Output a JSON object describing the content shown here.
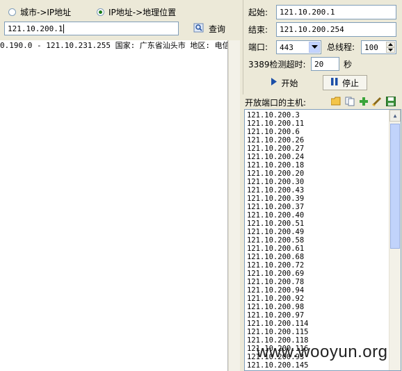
{
  "left": {
    "radio_city_to_ip": "城市->IP地址",
    "radio_ip_to_geo": "IP地址->地理位置",
    "selected_mode": "ip_to_geo",
    "query_input_value": "121.10.200.1",
    "query_button": "查询",
    "result_line": "0.190.0 - 121.10.231.255 国家: 广东省汕头市 地区: 电信"
  },
  "right": {
    "start_label": "起始:",
    "start_value": "121.10.200.1",
    "end_label": "结束:",
    "end_value": "121.10.200.254",
    "port_label": "端口:",
    "port_value": "443",
    "threads_label": "总线程:",
    "threads_value": "100",
    "timeout_label": "3389检测超时:",
    "timeout_value": "20",
    "timeout_unit": "秒",
    "start_button": "开始",
    "stop_button": "停止",
    "open_hosts_label": "开放端口的主机:",
    "toolbar_icons": [
      "folder-icon",
      "copy-icon",
      "add-icon",
      "clean-icon",
      "save-icon"
    ],
    "hosts": [
      "121.10.200.3",
      "121.10.200.11",
      "121.10.200.6",
      "121.10.200.26",
      "121.10.200.27",
      "121.10.200.24",
      "121.10.200.18",
      "121.10.200.20",
      "121.10.200.30",
      "121.10.200.43",
      "121.10.200.39",
      "121.10.200.37",
      "121.10.200.40",
      "121.10.200.51",
      "121.10.200.49",
      "121.10.200.58",
      "121.10.200.61",
      "121.10.200.68",
      "121.10.200.72",
      "121.10.200.69",
      "121.10.200.78",
      "121.10.200.94",
      "121.10.200.92",
      "121.10.200.98",
      "121.10.200.97",
      "121.10.200.114",
      "121.10.200.115",
      "121.10.200.118",
      "121.10.200.116",
      "121.10.200.93",
      "121.10.200.145"
    ]
  },
  "watermark": "www.wooyun.org",
  "colors": {
    "window_bg": "#ece9d8",
    "field_border": "#7f9db9",
    "accent_blue": "#1c4fa8"
  }
}
